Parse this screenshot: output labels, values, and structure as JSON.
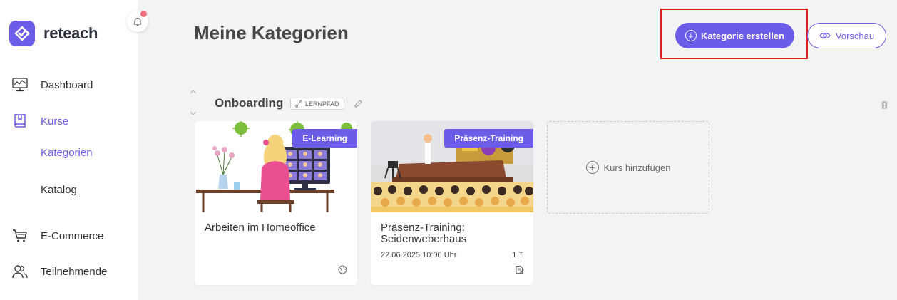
{
  "brand": {
    "name": "reteach",
    "color": "#6c5ce7"
  },
  "sidebar": {
    "items": [
      {
        "label": "Dashboard",
        "icon": "dashboard-icon"
      },
      {
        "label": "Kurse",
        "icon": "book-icon"
      },
      {
        "label": "E-Commerce",
        "icon": "cart-icon"
      },
      {
        "label": "Teilnehmende",
        "icon": "users-icon"
      }
    ],
    "sub_items": [
      {
        "label": "Kategorien"
      },
      {
        "label": "Katalog"
      }
    ]
  },
  "header": {
    "title": "Meine Kategorien",
    "create_label": "Kategorie erstellen",
    "preview_label": "Vorschau"
  },
  "category": {
    "title": "Onboarding",
    "badge": "LERNPFAD",
    "courses": [
      {
        "title": "Arbeiten im Homeoffice",
        "tag": "E-Learning"
      },
      {
        "title_line1": "Präsenz-Training:",
        "title_line2": "Seidenweberhaus",
        "tag": "Präsenz-Training",
        "date": "22.06.2025 10:00 Uhr",
        "duration": "1 T"
      }
    ],
    "add_course_label": "Kurs hinzufügen"
  }
}
